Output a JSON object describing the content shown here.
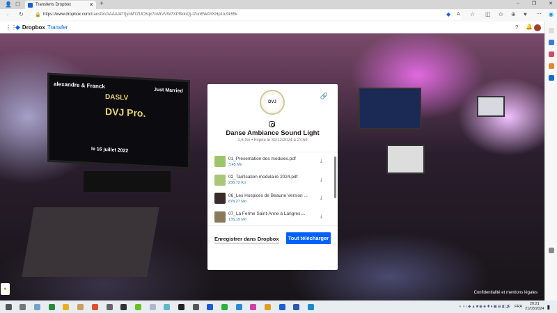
{
  "browser": {
    "tab_title": "Transferts Dropbox",
    "url_host": "https://www.dropbox.com",
    "url_path": "/transfer/AAAAAP7jynM7ZUC6qx7nMrVVW7XPf9doQj-t7onEWAYKHp1Iu9k55k"
  },
  "header": {
    "brand": "Dropbox",
    "product": "Transfer"
  },
  "transfer": {
    "seal_text": "DVJ Pro.",
    "title": "Danse Ambiance Sound Light",
    "meta": "1,6 Go • Expire le 31/12/2024 à 23:59",
    "files": [
      {
        "name": "01_Présentation des modules.pdf",
        "size": "3,45 Mo",
        "thumb": "#9cc46a"
      },
      {
        "name": "02_Tarification modulaire 2024.pdf",
        "size": "236,72 Ko",
        "thumb": "#a8c878"
      },
      {
        "name": "06_Les Hospices de Beaune Version ...",
        "size": "878,27 Mo",
        "thumb": "#3a2a2a"
      },
      {
        "name": "07_La Ferme Saint-Anne à Langres....",
        "size": "135,19 Mo",
        "thumb": "#8a7a5a"
      }
    ],
    "save_label": "Enregistrer dans Dropbox",
    "download_all_label": "Tout télécharger"
  },
  "background": {
    "screen_line1": "alexandre & Franck",
    "screen_line2": "DASLV",
    "screen_line3": "DVJ Pro.",
    "screen_line4": "Just Married",
    "screen_date": "le 16 juillet 2022"
  },
  "legal": "Confidentialité et mentions légales",
  "taskbar": {
    "lang": "FRA",
    "time": "20:21",
    "date": "21/03/2024",
    "apps": [
      "#555",
      "#777",
      "#7aa0c8",
      "#2a8a3a",
      "#e8b020",
      "#c8a060",
      "#e05030",
      "#666",
      "#333",
      "#6ac020",
      "#b0b8d0",
      "#60b8c8",
      "#222",
      "#555",
      "#1e5ad8",
      "#30b040",
      "#2a8ad8",
      "#d040a0",
      "#e0a020",
      "#1a5fd6",
      "#2a5ab0",
      "#1a8ad0"
    ]
  }
}
